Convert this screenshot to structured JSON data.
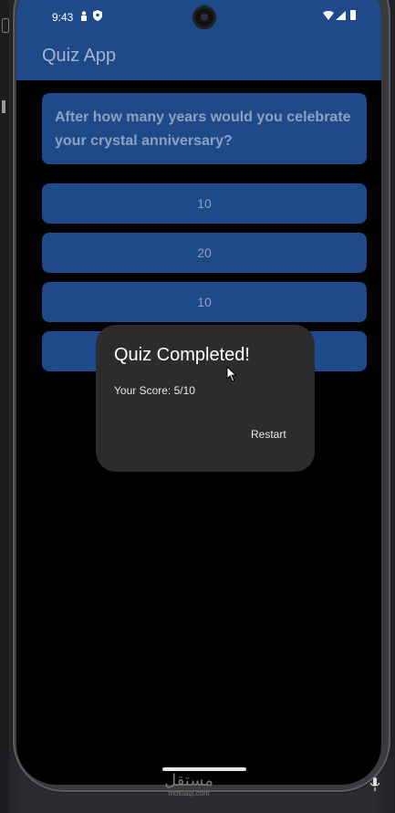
{
  "status_bar": {
    "time": "9:43",
    "icons": [
      "person-icon",
      "shield-icon",
      "camera-cutout",
      "wifi-icon",
      "signal-icon",
      "battery-icon"
    ]
  },
  "app_bar": {
    "title": "Quiz App"
  },
  "question": {
    "text": "After how many years would you celebrate your crystal anniversary?"
  },
  "options": [
    {
      "label": "10"
    },
    {
      "label": "20"
    },
    {
      "label": "10"
    },
    {
      "label": ""
    }
  ],
  "dialog": {
    "title": "Quiz Completed!",
    "score_text": "Your Score: 5/10",
    "restart_label": "Restart"
  },
  "watermark": {
    "arabic": "مستقل",
    "latin": "mostaql.com"
  },
  "colors": {
    "app_blue": "#1e4a8a",
    "dialog_bg": "#2c2c2e",
    "screen_bg": "#000000"
  }
}
